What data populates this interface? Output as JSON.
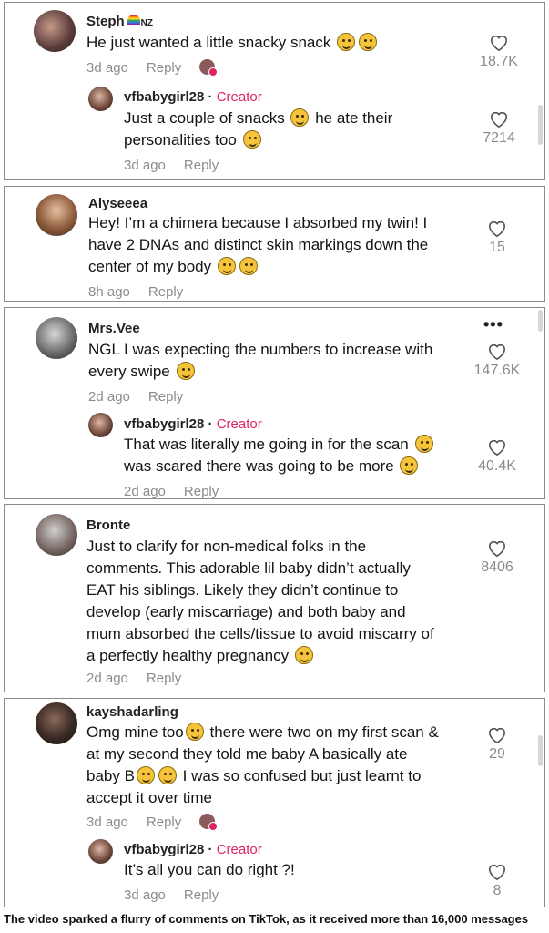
{
  "threads": [
    {
      "comment": {
        "username": "Steph",
        "badge": "NZ",
        "text": "He just wanted a little snacky snack",
        "time": "3d ago",
        "reply_label": "Reply",
        "likes": "18.7K"
      },
      "reply": {
        "username": "vfbabygirl28",
        "separator": " · ",
        "role": "Creator",
        "text_line1": "Just a couple of snacks",
        "text_line1b": "he ate their",
        "text_line2": "personalities too",
        "time": "3d ago",
        "reply_label": "Reply",
        "likes": "7214"
      }
    },
    {
      "comment": {
        "username": "Alyseeea",
        "text_line1": "Hey! I’m a chimera because I absorbed my twin! I",
        "text_line2": "have 2 DNAs and distinct skin markings down the",
        "text_line3": "center of my body",
        "time": "8h ago",
        "reply_label": "Reply",
        "likes": "15"
      }
    },
    {
      "comment": {
        "username": "Mrs.Vee",
        "text_line1": "NGL I was expecting the numbers to increase with",
        "text_line2": "every swipe",
        "time": "2d ago",
        "reply_label": "Reply",
        "likes": "147.6K"
      },
      "reply": {
        "username": "vfbabygirl28",
        "separator": " · ",
        "role": "Creator",
        "text_line1": "That was literally me going in for the scan",
        "text_line2": "was scared there was going to be more",
        "time": "2d ago",
        "reply_label": "Reply",
        "likes": "40.4K"
      }
    },
    {
      "comment": {
        "username": "Bronte",
        "text_line1": "Just to clarify for non-medical folks in the",
        "text_line2": "comments. This adorable lil baby didn’t actually",
        "text_line3": "EAT his siblings. Likely they didn’t continue to",
        "text_line4": "develop (early miscarriage) and both baby and",
        "text_line5": "mum absorbed the cells/tissue to avoid miscarry of",
        "text_line6": "a perfectly healthy pregnancy",
        "time": "2d ago",
        "reply_label": "Reply",
        "likes": "8406"
      }
    },
    {
      "comment": {
        "username": "kayshadarling",
        "text_line1a": "Omg mine too",
        "text_line1b": "there were two on my first scan &",
        "text_line2": "at my second they told me baby A basically ate",
        "text_line3a": "baby B",
        "text_line3b": "I was so confused but just learnt to",
        "text_line4": "accept it over time",
        "time": "3d ago",
        "reply_label": "Reply",
        "likes": "29"
      },
      "reply": {
        "username": "vfbabygirl28",
        "separator": " · ",
        "role": "Creator",
        "text": "It’s all you can do right ?!",
        "time": "3d ago",
        "reply_label": "Reply",
        "likes": "8"
      }
    }
  ],
  "caption": "The video sparked a flurry of comments on TikTok, as it received more than 16,000 messages",
  "colors": {
    "creator": "#e0245e",
    "muted": "#8c8c8c",
    "border": "#8a8a8a"
  },
  "icons": {
    "like": "heart-outline-icon",
    "more": "more-dots-icon"
  }
}
